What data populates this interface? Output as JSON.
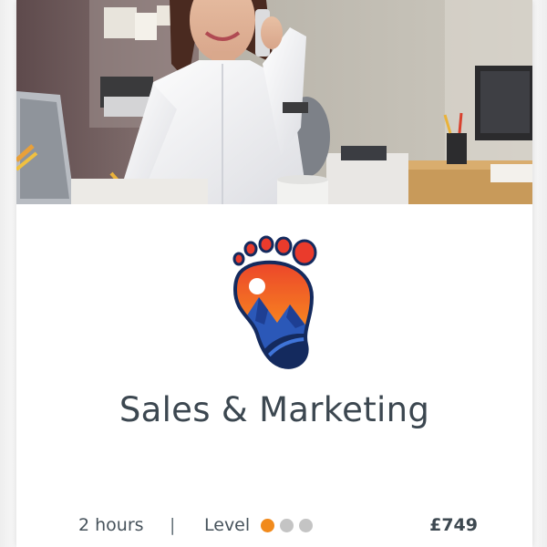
{
  "course": {
    "title": "Sales & Marketing",
    "duration": "2 hours",
    "separator": "|",
    "level_label": "Level",
    "level": 1,
    "level_max": 3,
    "price": "£749"
  },
  "hero": {
    "subject": "woman on phone at office desk",
    "icon": "hero-photo"
  },
  "logo": {
    "icon": "footprint-mountain-logo"
  },
  "colors": {
    "level_active": "#f18a1c",
    "level_inactive": "#c4c4c4",
    "title_text": "#3c4750",
    "logo_orange": "#f47b20",
    "logo_blue": "#1e3f93",
    "logo_red": "#ea3b2c"
  }
}
